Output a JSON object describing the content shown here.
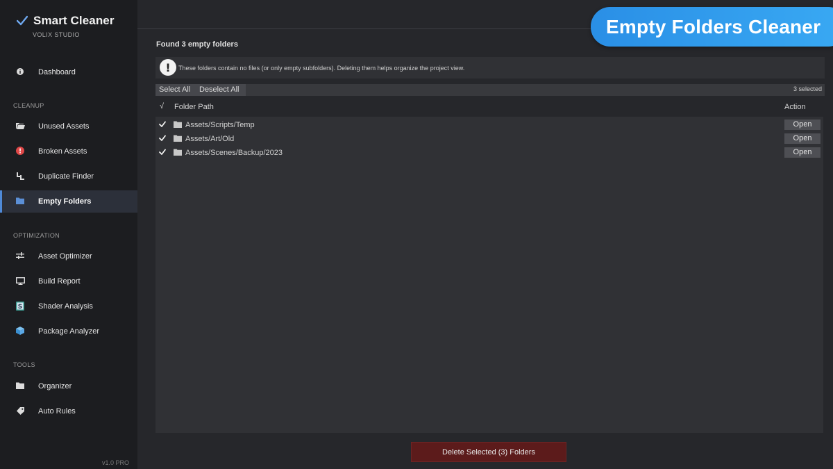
{
  "app": {
    "title": "Smart Cleaner",
    "studio": "VOLIX STUDIO",
    "version": "v1.0 PRO"
  },
  "sidebar": {
    "dashboard": {
      "label": "Dashboard",
      "icon": "info-icon"
    },
    "sections": {
      "cleanup": "CLEANUP",
      "optimization": "OPTIMIZATION",
      "tools": "TOOLS"
    },
    "cleanup_items": [
      {
        "label": "Unused Assets",
        "icon": "folder-open-icon"
      },
      {
        "label": "Broken Assets",
        "icon": "error-icon"
      },
      {
        "label": "Duplicate Finder",
        "icon": "duplicate-icon"
      },
      {
        "label": "Empty Folders",
        "icon": "folder-icon",
        "active": true
      }
    ],
    "optimization_items": [
      {
        "label": "Asset Optimizer",
        "icon": "sliders-icon"
      },
      {
        "label": "Build Report",
        "icon": "monitor-icon"
      },
      {
        "label": "Shader Analysis",
        "icon": "shader-icon"
      },
      {
        "label": "Package Analyzer",
        "icon": "package-icon"
      }
    ],
    "tools_items": [
      {
        "label": "Organizer",
        "icon": "folder-icon"
      },
      {
        "label": "Auto Rules",
        "icon": "tag-icon"
      }
    ]
  },
  "banner": {
    "title": "Empty Folders Cleaner"
  },
  "main": {
    "found_text": "Found 3 empty folders",
    "info_text": "These folders contain no files (or only empty subfolders). Deleting them helps organize the project view.",
    "toolbar": {
      "select_all": "Select All",
      "deselect_all": "Deselect All",
      "selected_count": "3 selected"
    },
    "columns": {
      "check": "√",
      "path": "Folder Path",
      "action": "Action"
    },
    "rows": [
      {
        "path": "Assets/Scripts/Temp",
        "checked": true,
        "action": "Open"
      },
      {
        "path": "Assets/Art/Old",
        "checked": true,
        "action": "Open"
      },
      {
        "path": "Assets/Scenes/Backup/2023",
        "checked": true,
        "action": "Open"
      }
    ],
    "delete_button": "Delete Selected (3) Folders"
  },
  "colors": {
    "accent": "#4f8ad8",
    "banner": "#2a8fe6",
    "danger": "#5c1b1b",
    "error": "#e04848"
  }
}
